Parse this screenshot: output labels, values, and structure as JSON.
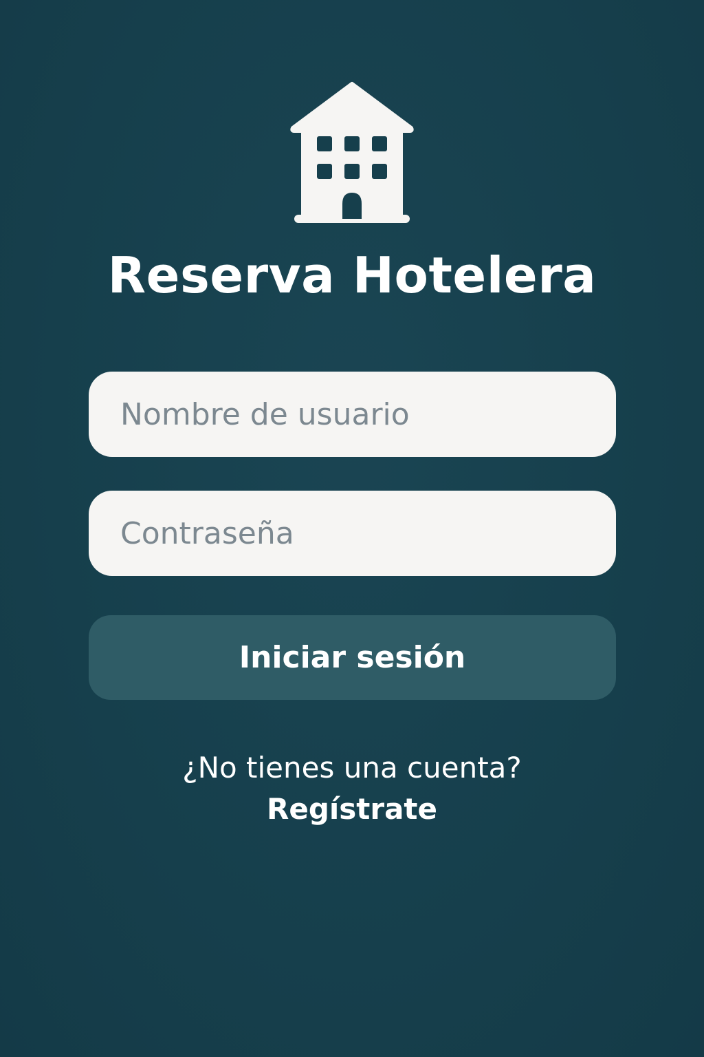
{
  "app": {
    "title": "Reserva Hotelera",
    "logo_icon": "hotel-building-icon"
  },
  "form": {
    "username_placeholder": "Nombre de usuario",
    "username_value": "",
    "password_placeholder": "Contraseña",
    "password_value": "",
    "submit_label": "Iniciar sesión"
  },
  "signup": {
    "prompt": "¿No tienes una cuenta?",
    "link_label": "Regístrate"
  },
  "colors": {
    "background": "#163f4c",
    "field_background": "#f6f5f3",
    "button_background": "#2f5c66",
    "text_primary": "#ffffff",
    "placeholder_text": "#7c8890"
  }
}
